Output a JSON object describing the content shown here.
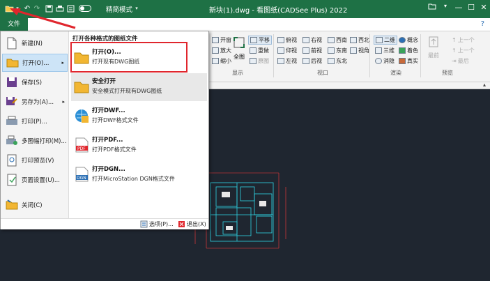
{
  "titlebar": {
    "title": "新块(1).dwg - 看图纸(CADSee Plus) 2022",
    "mode_label": "精简模式",
    "qa_icons": [
      "folder-open-icon",
      "chevron-down-icon",
      "undo-icon",
      "redo-icon",
      "save-icon",
      "print-icon",
      "printer-preview-icon",
      "toggle-icon"
    ],
    "window_controls": [
      "minimize-icon",
      "maximize-icon",
      "close-icon"
    ],
    "extra_icons": [
      "folder-icon",
      "dropdown-icon",
      "help-icon"
    ]
  },
  "tabs": {
    "file": "文件"
  },
  "ribbon": {
    "nav_buttons": [
      "平移",
      "全图",
      "重做",
      "原图",
      "开窗",
      "放大",
      "缩小"
    ],
    "groups": {
      "display": "显示",
      "view": "视口",
      "render": "渲染",
      "preview": "预览"
    },
    "view_buttons": [
      "俯视",
      "右视",
      "西南",
      "西北",
      "仰视",
      "前视",
      "东南",
      "视角",
      "左视",
      "后视",
      "东北"
    ],
    "render_buttons": [
      "二维",
      "概念",
      "三维",
      "着色",
      "消隐",
      "真实"
    ],
    "preview_buttons": [
      "上一个",
      "上一个",
      "最前",
      "最后"
    ]
  },
  "filemenu": {
    "left_items": [
      {
        "label": "新建(N)",
        "icon": "new-document-icon"
      },
      {
        "label": "打开(O)...",
        "icon": "folder-open-icon"
      },
      {
        "label": "保存(S)",
        "icon": "save-icon"
      },
      {
        "label": "另存为(A)...",
        "icon": "save-as-icon"
      },
      {
        "label": "打印(P)...",
        "icon": "print-icon"
      },
      {
        "label": "多图幅打印(M)...",
        "icon": "batch-print-icon"
      },
      {
        "label": "打印预览(V)",
        "icon": "print-preview-icon"
      },
      {
        "label": "页面设置(U)...",
        "icon": "page-setup-icon"
      },
      {
        "label": "关闭(C)",
        "icon": "close-folder-icon"
      }
    ],
    "right_header": "打开各种格式的图纸文件",
    "right_items": [
      {
        "title": "打开(O)...",
        "desc": "打开现有DWG图纸",
        "icon": "folder-open-icon"
      },
      {
        "title": "安全打开",
        "desc": "安全模式打开现有DWG图纸",
        "icon": "safe-open-icon"
      },
      {
        "title": "打开DWF...",
        "desc": "打开DWF格式文件",
        "icon": "dwf-globe-icon"
      },
      {
        "title": "打开PDF...",
        "desc": "打开PDF格式文件",
        "icon": "pdf-icon"
      },
      {
        "title": "打开DGN...",
        "desc": "打开MicroStation DGN格式文件",
        "icon": "dgn-icon"
      }
    ],
    "bottom": {
      "options": "选项(P)...",
      "exit": "退出(X)"
    }
  },
  "colors": {
    "title_bar": "#1e7145",
    "highlight_box": "#e0262d",
    "canvas": "#1f2630",
    "cad_lines": "#2fd6e6",
    "dimension_red": "#ff3b3b"
  }
}
